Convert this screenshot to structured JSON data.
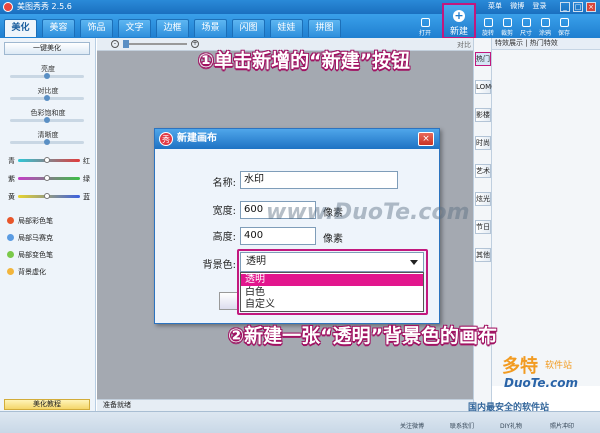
{
  "window": {
    "title": "美图秀秀 2.5.6",
    "links": [
      "菜单",
      "微博",
      "登录"
    ],
    "buttons": {
      "min": "_",
      "max": "□",
      "close": "×"
    }
  },
  "tabs": [
    {
      "label": "美化",
      "active": true
    },
    {
      "label": "美容",
      "active": false
    },
    {
      "label": "饰品",
      "active": false
    },
    {
      "label": "文字",
      "active": false
    },
    {
      "label": "边框",
      "active": false
    },
    {
      "label": "场景",
      "active": false
    },
    {
      "label": "闪图",
      "active": false
    },
    {
      "label": "娃娃",
      "active": false
    },
    {
      "label": "拼图",
      "active": false
    }
  ],
  "toolbar": {
    "open": "打开",
    "new": "新建",
    "rotate": "旋转",
    "crop": "裁剪",
    "size": "尺寸",
    "eraser": "涂鸦",
    "save": "保存"
  },
  "left_panel": {
    "one_click": "一键美化",
    "sliders": [
      {
        "label": "亮度",
        "value": 0.5
      },
      {
        "label": "对比度",
        "value": 0.5
      },
      {
        "label": "色彩饱和度",
        "value": 0.5
      },
      {
        "label": "清晰度",
        "value": 0.5
      }
    ],
    "color_rows": [
      {
        "left": "青",
        "right": "红"
      },
      {
        "left": "紫",
        "right": "绿"
      },
      {
        "left": "黄",
        "right": "蓝"
      }
    ],
    "tools": [
      "局部彩色笔",
      "局部马赛克",
      "局部变色笔",
      "背景虚化"
    ],
    "tutorial": "美化教程"
  },
  "canvas": {
    "compare": "对比",
    "status": "准备就绪"
  },
  "right_panel": {
    "tabs_text": "特效展示 | 热门特效",
    "vtabs": [
      "热门",
      "LOMO",
      "影楼",
      "时尚",
      "艺术",
      "炫光",
      "节日",
      "其他"
    ]
  },
  "dialog": {
    "title": "新建画布",
    "logo_char": "秀",
    "close": "×",
    "name_label": "名称:",
    "name_value": "水印",
    "width_label": "宽度:",
    "width_value": "600",
    "width_unit": "像素",
    "height_label": "高度:",
    "height_value": "400",
    "height_unit": "像素",
    "bg_label": "背景色:",
    "bg_selected": "透明",
    "bg_options": [
      "透明",
      "白色",
      "自定义"
    ]
  },
  "annotations": {
    "step1": "①单击新增的“新建”按钮",
    "step2": "②新建一张“透明”背景色的画布"
  },
  "watermarks": {
    "duote": "www.DuoTe.com",
    "logo_big": "多特",
    "logo_small": "软件站",
    "logo_url": "DuoTe.com",
    "footer": "国内最安全的软件站"
  },
  "statusbar": {
    "links": [
      "关注微博",
      "联系我们",
      "DIY礼物",
      "照片冲印"
    ]
  }
}
